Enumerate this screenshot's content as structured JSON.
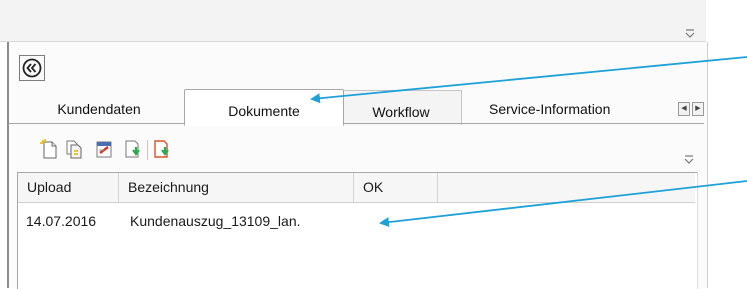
{
  "tabs": [
    {
      "label": "Kundendaten",
      "active": false
    },
    {
      "label": "Dokumente",
      "active": true
    },
    {
      "label": "Workflow",
      "active": false
    },
    {
      "label": "Service-Information",
      "active": false
    }
  ],
  "tab_scroll": {
    "left_glyph": "◀",
    "right_glyph": "▶"
  },
  "toolbar": {
    "icons": [
      "new-document-icon",
      "copy-document-icon",
      "edit-document-icon",
      "import-document-icon",
      "export-document-icon"
    ]
  },
  "grid": {
    "columns": [
      "Upload",
      "Bezeichnung",
      "OK"
    ],
    "rows": [
      {
        "upload": "14.07.2016",
        "bezeichnung": "Kundenauszug_13109_lan.",
        "ok": ""
      }
    ]
  },
  "annotation_color": "#1ea0d8"
}
